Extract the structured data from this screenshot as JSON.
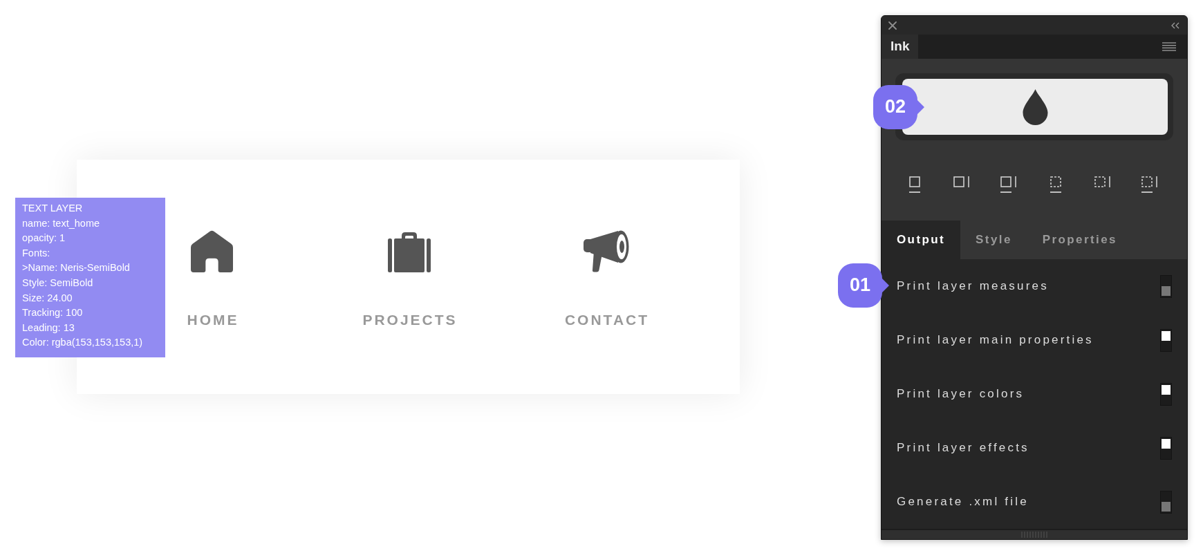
{
  "layer_info": {
    "lines": [
      "TEXT LAYER",
      "name: text_home",
      "opacity: 1",
      "Fonts:",
      ">Name: Neris-SemiBold",
      "Style: SemiBold",
      "Size: 24.00",
      "Tracking: 100",
      "Leading: 13",
      "Color: rgba(153,153,153,1)"
    ]
  },
  "nav_card": {
    "items": [
      "HOME",
      "PROJECTS",
      "CONTACT"
    ]
  },
  "panel": {
    "tab": "Ink",
    "preview": {
      "callout": "02"
    },
    "tabs": [
      {
        "label": "Output",
        "selected": true
      },
      {
        "label": "Style",
        "selected": false
      },
      {
        "label": "Properties",
        "selected": false
      }
    ],
    "options": {
      "callout": "01",
      "items": [
        {
          "label": "Print layer measures",
          "checked": false
        },
        {
          "label": "Print layer main properties",
          "checked": true
        },
        {
          "label": "Print layer colors",
          "checked": true
        },
        {
          "label": "Print layer effects",
          "checked": true
        },
        {
          "label": "Generate .xml file",
          "checked": false
        }
      ]
    }
  }
}
